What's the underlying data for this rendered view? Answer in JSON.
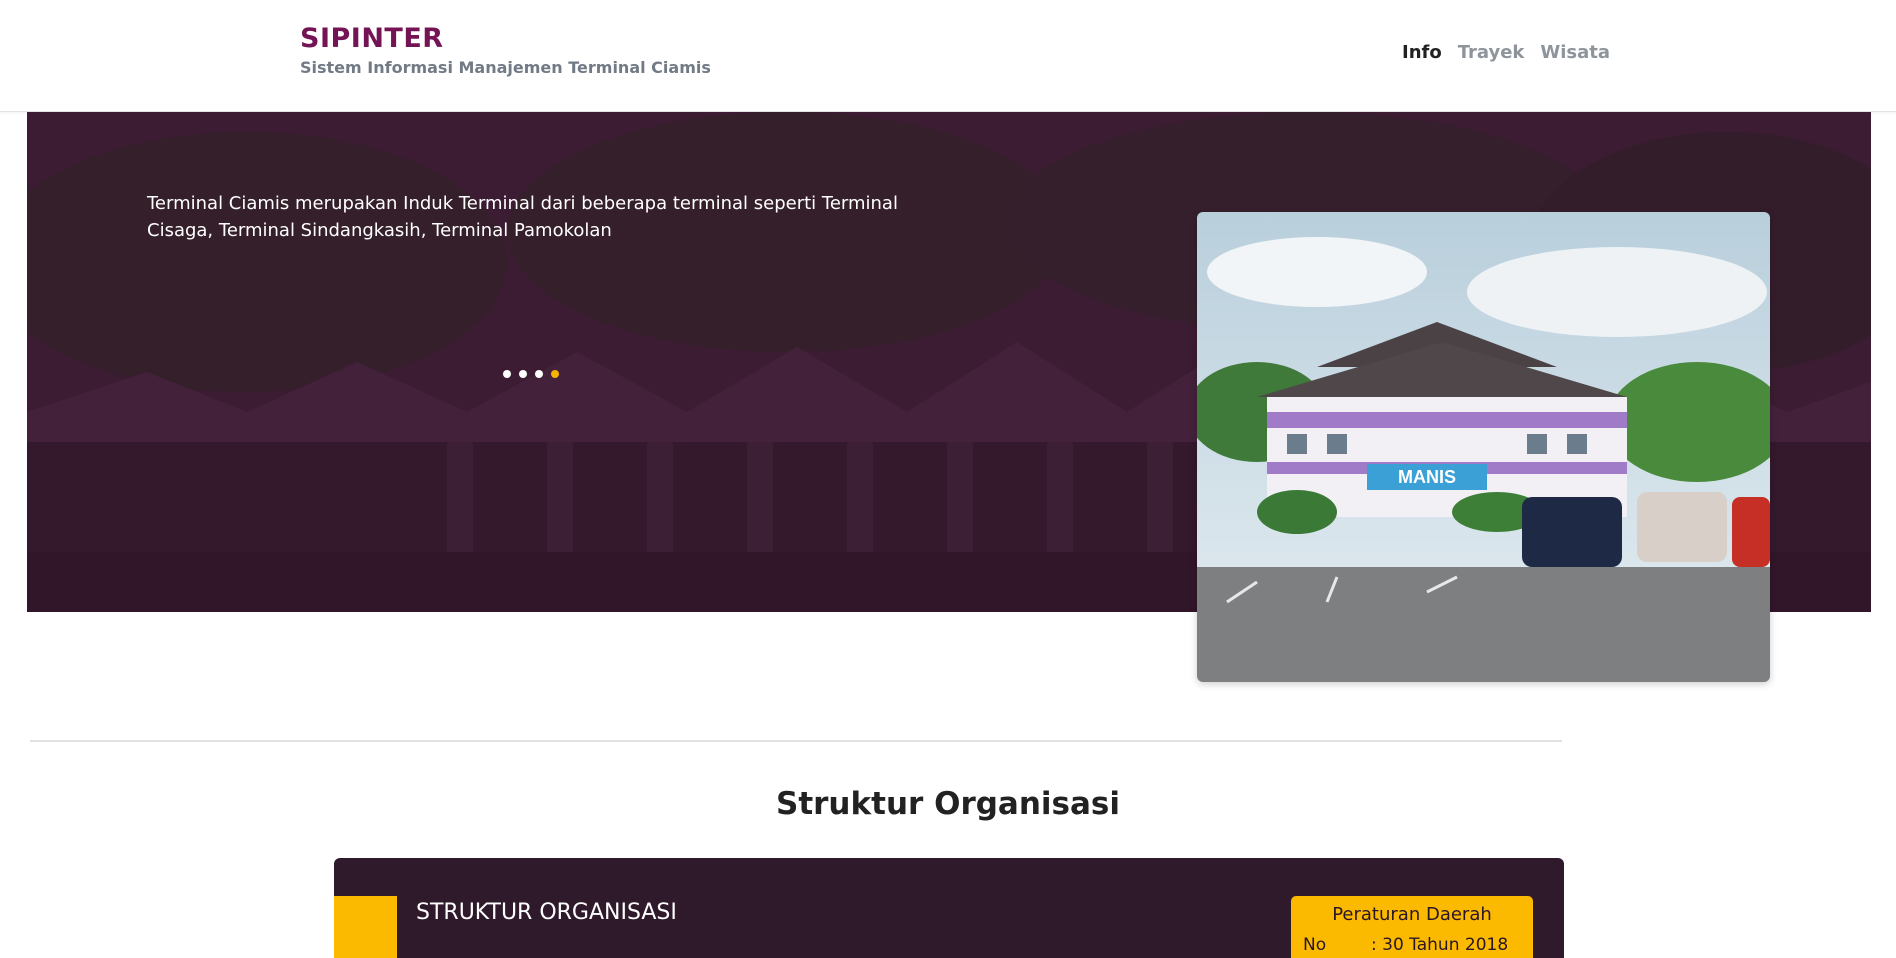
{
  "header": {
    "brand_title": "SIPINTER",
    "brand_subtitle": "Sistem Informasi Manajemen Terminal Ciamis",
    "nav": [
      "Info",
      "Trayek",
      "Wisata"
    ],
    "active_nav": "Info"
  },
  "hero": {
    "description": "Terminal Ciamis merupakan Induk Terminal dari beberapa terminal seperti Terminal Cisaga, Terminal Sindangkasih, Terminal Pamokolan",
    "carousel_count": 4,
    "carousel_active_index": 3,
    "photo_sign": "MANIS"
  },
  "organization": {
    "section_title": "Struktur Organisasi",
    "card_title": "STRUKTUR ORGANISASI",
    "perda": {
      "title": "Peraturan Daerah",
      "label": "No",
      "value": ": 30 Tahun 2018"
    }
  },
  "colors": {
    "brand": "#741455",
    "accent": "#fbba00",
    "card_bg": "#2f1a2b"
  }
}
